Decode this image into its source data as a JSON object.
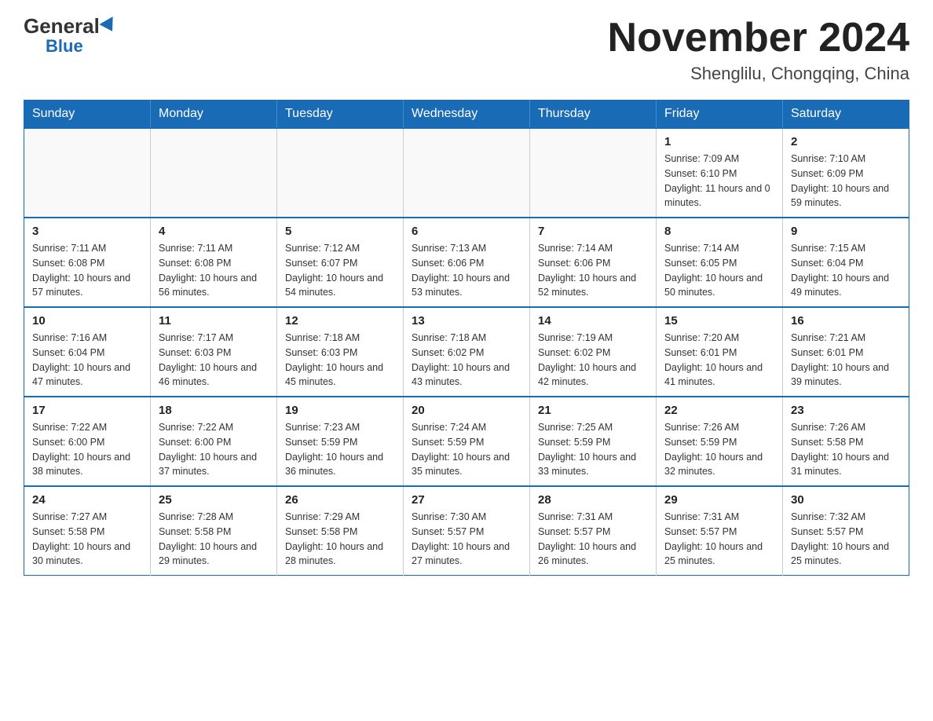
{
  "header": {
    "logo_general": "General",
    "logo_blue": "Blue",
    "month_year": "November 2024",
    "location": "Shenglilu, Chongqing, China"
  },
  "days_of_week": [
    "Sunday",
    "Monday",
    "Tuesday",
    "Wednesday",
    "Thursday",
    "Friday",
    "Saturday"
  ],
  "weeks": [
    [
      {
        "day": "",
        "sunrise": "",
        "sunset": "",
        "daylight": ""
      },
      {
        "day": "",
        "sunrise": "",
        "sunset": "",
        "daylight": ""
      },
      {
        "day": "",
        "sunrise": "",
        "sunset": "",
        "daylight": ""
      },
      {
        "day": "",
        "sunrise": "",
        "sunset": "",
        "daylight": ""
      },
      {
        "day": "",
        "sunrise": "",
        "sunset": "",
        "daylight": ""
      },
      {
        "day": "1",
        "sunrise": "Sunrise: 7:09 AM",
        "sunset": "Sunset: 6:10 PM",
        "daylight": "Daylight: 11 hours and 0 minutes."
      },
      {
        "day": "2",
        "sunrise": "Sunrise: 7:10 AM",
        "sunset": "Sunset: 6:09 PM",
        "daylight": "Daylight: 10 hours and 59 minutes."
      }
    ],
    [
      {
        "day": "3",
        "sunrise": "Sunrise: 7:11 AM",
        "sunset": "Sunset: 6:08 PM",
        "daylight": "Daylight: 10 hours and 57 minutes."
      },
      {
        "day": "4",
        "sunrise": "Sunrise: 7:11 AM",
        "sunset": "Sunset: 6:08 PM",
        "daylight": "Daylight: 10 hours and 56 minutes."
      },
      {
        "day": "5",
        "sunrise": "Sunrise: 7:12 AM",
        "sunset": "Sunset: 6:07 PM",
        "daylight": "Daylight: 10 hours and 54 minutes."
      },
      {
        "day": "6",
        "sunrise": "Sunrise: 7:13 AM",
        "sunset": "Sunset: 6:06 PM",
        "daylight": "Daylight: 10 hours and 53 minutes."
      },
      {
        "day": "7",
        "sunrise": "Sunrise: 7:14 AM",
        "sunset": "Sunset: 6:06 PM",
        "daylight": "Daylight: 10 hours and 52 minutes."
      },
      {
        "day": "8",
        "sunrise": "Sunrise: 7:14 AM",
        "sunset": "Sunset: 6:05 PM",
        "daylight": "Daylight: 10 hours and 50 minutes."
      },
      {
        "day": "9",
        "sunrise": "Sunrise: 7:15 AM",
        "sunset": "Sunset: 6:04 PM",
        "daylight": "Daylight: 10 hours and 49 minutes."
      }
    ],
    [
      {
        "day": "10",
        "sunrise": "Sunrise: 7:16 AM",
        "sunset": "Sunset: 6:04 PM",
        "daylight": "Daylight: 10 hours and 47 minutes."
      },
      {
        "day": "11",
        "sunrise": "Sunrise: 7:17 AM",
        "sunset": "Sunset: 6:03 PM",
        "daylight": "Daylight: 10 hours and 46 minutes."
      },
      {
        "day": "12",
        "sunrise": "Sunrise: 7:18 AM",
        "sunset": "Sunset: 6:03 PM",
        "daylight": "Daylight: 10 hours and 45 minutes."
      },
      {
        "day": "13",
        "sunrise": "Sunrise: 7:18 AM",
        "sunset": "Sunset: 6:02 PM",
        "daylight": "Daylight: 10 hours and 43 minutes."
      },
      {
        "day": "14",
        "sunrise": "Sunrise: 7:19 AM",
        "sunset": "Sunset: 6:02 PM",
        "daylight": "Daylight: 10 hours and 42 minutes."
      },
      {
        "day": "15",
        "sunrise": "Sunrise: 7:20 AM",
        "sunset": "Sunset: 6:01 PM",
        "daylight": "Daylight: 10 hours and 41 minutes."
      },
      {
        "day": "16",
        "sunrise": "Sunrise: 7:21 AM",
        "sunset": "Sunset: 6:01 PM",
        "daylight": "Daylight: 10 hours and 39 minutes."
      }
    ],
    [
      {
        "day": "17",
        "sunrise": "Sunrise: 7:22 AM",
        "sunset": "Sunset: 6:00 PM",
        "daylight": "Daylight: 10 hours and 38 minutes."
      },
      {
        "day": "18",
        "sunrise": "Sunrise: 7:22 AM",
        "sunset": "Sunset: 6:00 PM",
        "daylight": "Daylight: 10 hours and 37 minutes."
      },
      {
        "day": "19",
        "sunrise": "Sunrise: 7:23 AM",
        "sunset": "Sunset: 5:59 PM",
        "daylight": "Daylight: 10 hours and 36 minutes."
      },
      {
        "day": "20",
        "sunrise": "Sunrise: 7:24 AM",
        "sunset": "Sunset: 5:59 PM",
        "daylight": "Daylight: 10 hours and 35 minutes."
      },
      {
        "day": "21",
        "sunrise": "Sunrise: 7:25 AM",
        "sunset": "Sunset: 5:59 PM",
        "daylight": "Daylight: 10 hours and 33 minutes."
      },
      {
        "day": "22",
        "sunrise": "Sunrise: 7:26 AM",
        "sunset": "Sunset: 5:59 PM",
        "daylight": "Daylight: 10 hours and 32 minutes."
      },
      {
        "day": "23",
        "sunrise": "Sunrise: 7:26 AM",
        "sunset": "Sunset: 5:58 PM",
        "daylight": "Daylight: 10 hours and 31 minutes."
      }
    ],
    [
      {
        "day": "24",
        "sunrise": "Sunrise: 7:27 AM",
        "sunset": "Sunset: 5:58 PM",
        "daylight": "Daylight: 10 hours and 30 minutes."
      },
      {
        "day": "25",
        "sunrise": "Sunrise: 7:28 AM",
        "sunset": "Sunset: 5:58 PM",
        "daylight": "Daylight: 10 hours and 29 minutes."
      },
      {
        "day": "26",
        "sunrise": "Sunrise: 7:29 AM",
        "sunset": "Sunset: 5:58 PM",
        "daylight": "Daylight: 10 hours and 28 minutes."
      },
      {
        "day": "27",
        "sunrise": "Sunrise: 7:30 AM",
        "sunset": "Sunset: 5:57 PM",
        "daylight": "Daylight: 10 hours and 27 minutes."
      },
      {
        "day": "28",
        "sunrise": "Sunrise: 7:31 AM",
        "sunset": "Sunset: 5:57 PM",
        "daylight": "Daylight: 10 hours and 26 minutes."
      },
      {
        "day": "29",
        "sunrise": "Sunrise: 7:31 AM",
        "sunset": "Sunset: 5:57 PM",
        "daylight": "Daylight: 10 hours and 25 minutes."
      },
      {
        "day": "30",
        "sunrise": "Sunrise: 7:32 AM",
        "sunset": "Sunset: 5:57 PM",
        "daylight": "Daylight: 10 hours and 25 minutes."
      }
    ]
  ]
}
